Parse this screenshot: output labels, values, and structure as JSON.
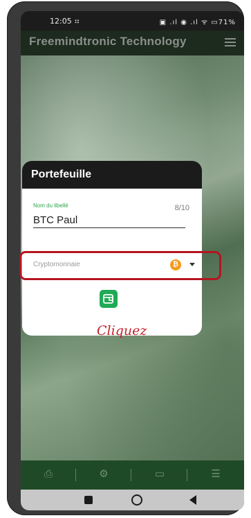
{
  "statusbar": {
    "time": "12:05",
    "time_glyph": "⠶",
    "right_indicators": "▣ .ıl ◉ .ıl ᯤ ▭71%"
  },
  "appbar": {
    "title": "Freemindtronic Technology"
  },
  "dialog": {
    "title": "Portefeuille",
    "name_label": "Nom du libellé",
    "name_value": "BTC Paul",
    "name_counter": "8/10",
    "crypto_placeholder": "Cryptomonnaie",
    "btc_symbol": "₿",
    "annotation": "Cliquez"
  },
  "colors": {
    "accent_green": "#1faa55",
    "highlight_red": "#b5151f",
    "bitcoin_orange": "#f39a1d",
    "tabbar_green": "#1f4a27"
  },
  "tabbar": {
    "icons": [
      {
        "name": "printer-icon",
        "glyph": "⎙"
      },
      {
        "name": "gear-icon",
        "glyph": "⚙"
      },
      {
        "name": "devices-icon",
        "glyph": "▭"
      },
      {
        "name": "document-search-icon",
        "glyph": "☰"
      }
    ]
  },
  "navbar": {
    "icons": [
      "recents-square-icon",
      "home-circle-icon",
      "back-triangle-icon"
    ]
  }
}
